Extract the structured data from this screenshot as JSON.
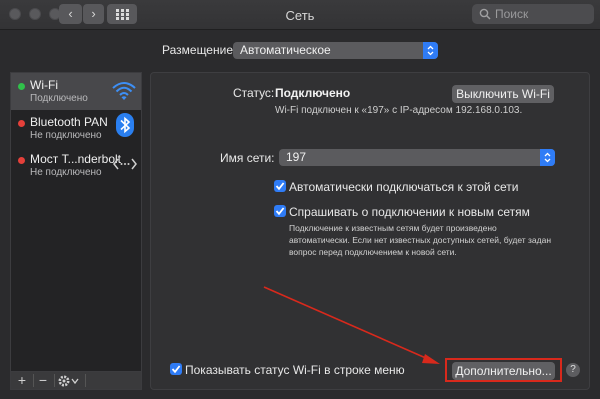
{
  "window": {
    "title": "Сеть"
  },
  "toolbar": {
    "back": "‹",
    "forward": "›",
    "search_placeholder": "Поиск"
  },
  "location": {
    "label": "Размещение:",
    "value": "Автоматическое"
  },
  "sidebar": {
    "items": [
      {
        "name": "Wi-Fi",
        "status": "Подключено",
        "status_color": "#30c14a",
        "icon": "wifi-icon"
      },
      {
        "name": "Bluetooth PAN",
        "status": "Не подключено",
        "status_color": "#e5403a",
        "icon": "bluetooth-icon"
      },
      {
        "name": "Мост T...nderbolt",
        "status": "Не подключено",
        "status_color": "#e5403a",
        "icon": "thunderbolt-bridge-icon"
      }
    ],
    "add": "+",
    "remove": "−"
  },
  "wifi": {
    "status_label": "Статус:",
    "status_value": "Подключено",
    "toggle_button": "Выключить Wi-Fi",
    "status_detail": "Wi-Fi подключен к «197» с IP-адресом 192.168.0.103.",
    "network_label": "Имя сети:",
    "network_value": "197",
    "auto_join": "Автоматически подключаться к этой сети",
    "ask_new": "Спрашивать о подключении к новым сетям",
    "ask_note": "Подключение к известным сетям будет произведено автоматически. Если нет известных доступных сетей, будет задан вопрос перед подключением к новой сети.",
    "show_in_menu": "Показывать статус Wi-Fi в строке меню",
    "advanced_button": "Дополнительно...",
    "help": "?"
  },
  "colors": {
    "accent": "#2f7cf6",
    "highlight": "#d8291c"
  }
}
